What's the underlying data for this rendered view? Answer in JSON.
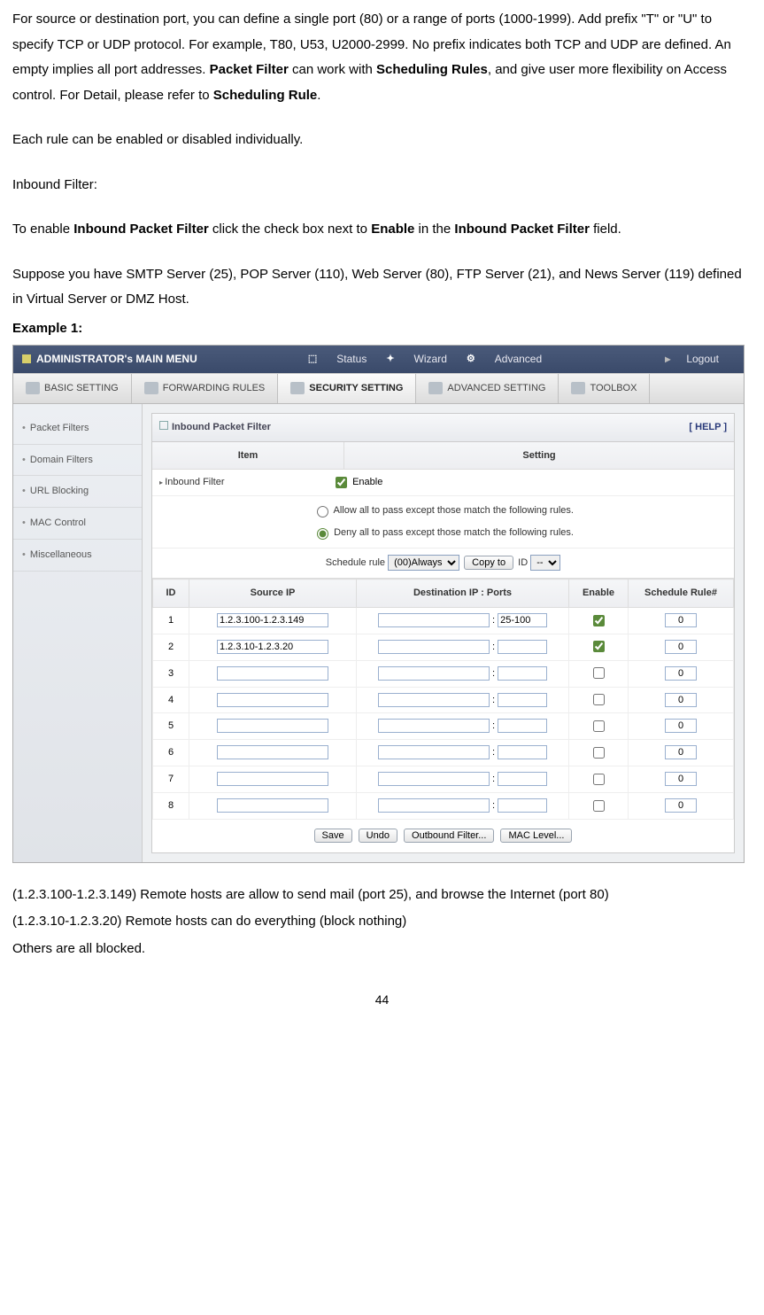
{
  "intro": {
    "p1_a": "For source or destination port, you can define a single port (80) or a range of ports (1000-1999). Add prefix \"T\" or \"U\" to specify TCP or UDP protocol. For example, T80, U53, U2000-2999. No prefix indicates both TCP and UDP are defined. An empty implies all port addresses. ",
    "p1_b1": "Packet Filter",
    "p1_c": " can work with ",
    "p1_b2": "Scheduling Rules",
    "p1_d": ", and give user more flexibility on Access control. For Detail, please refer to ",
    "p1_b3": "Scheduling Rule",
    "p1_e": ".",
    "p2": "Each rule can be enabled or disabled individually.",
    "p3": "Inbound Filter:",
    "p4_a": "To enable ",
    "p4_b1": "Inbound Packet Filter",
    "p4_c": " click the check box next to ",
    "p4_b2": "Enable",
    "p4_d": " in the ",
    "p4_b3": "Inbound Packet Filter",
    "p4_e": " field.",
    "p5": "Suppose you have SMTP Server (25), POP Server (110), Web Server (80), FTP Server (21), and News Server (119) defined in Virtual Server or DMZ Host.",
    "p6": "Example 1:"
  },
  "topbar": {
    "title": "ADMINISTRATOR's MAIN MENU",
    "status": "Status",
    "wizard": "Wizard",
    "advanced": "Advanced",
    "logout": "Logout"
  },
  "tabs": {
    "basic": "BASIC SETTING",
    "forwarding": "FORWARDING RULES",
    "security": "SECURITY SETTING",
    "advanced": "ADVANCED SETTING",
    "toolbox": "TOOLBOX"
  },
  "sidebar": {
    "items": [
      "Packet Filters",
      "Domain Filters",
      "URL Blocking",
      "MAC Control",
      "Miscellaneous"
    ]
  },
  "panel": {
    "title": "Inbound Packet Filter",
    "help": "[ HELP ]",
    "item_hdr": "Item",
    "setting_hdr": "Setting",
    "inbound_lbl": "Inbound Filter",
    "enable_lbl": "Enable",
    "radio_allow": "Allow all to pass except those match the following rules.",
    "radio_deny": "Deny all to pass except those match the following rules.",
    "sched_lbl": "Schedule rule",
    "sched_opt": "(00)Always",
    "copy_btn": "Copy to",
    "id_lbl": "ID",
    "id_opt": "--"
  },
  "rules": {
    "hdr_id": "ID",
    "hdr_src": "Source IP",
    "hdr_dst": "Destination IP : Ports",
    "hdr_enable": "Enable",
    "hdr_sched": "Schedule Rule#",
    "rows": [
      {
        "id": "1",
        "src": "1.2.3.100-1.2.3.149",
        "dst": "",
        "ports": "25-100",
        "enable": true,
        "sched": "0"
      },
      {
        "id": "2",
        "src": "1.2.3.10-1.2.3.20",
        "dst": "",
        "ports": "",
        "enable": true,
        "sched": "0"
      },
      {
        "id": "3",
        "src": "",
        "dst": "",
        "ports": "",
        "enable": false,
        "sched": "0"
      },
      {
        "id": "4",
        "src": "",
        "dst": "",
        "ports": "",
        "enable": false,
        "sched": "0"
      },
      {
        "id": "5",
        "src": "",
        "dst": "",
        "ports": "",
        "enable": false,
        "sched": "0"
      },
      {
        "id": "6",
        "src": "",
        "dst": "",
        "ports": "",
        "enable": false,
        "sched": "0"
      },
      {
        "id": "7",
        "src": "",
        "dst": "",
        "ports": "",
        "enable": false,
        "sched": "0"
      },
      {
        "id": "8",
        "src": "",
        "dst": "",
        "ports": "",
        "enable": false,
        "sched": "0"
      }
    ]
  },
  "buttons": {
    "save": "Save",
    "undo": "Undo",
    "outbound": "Outbound Filter...",
    "mac": "MAC Level..."
  },
  "footer": {
    "f1": "(1.2.3.100-1.2.3.149) Remote hosts are allow to send mail (port 25), and browse the Internet (port 80)",
    "f2": "(1.2.3.10-1.2.3.20) Remote hosts can do everything (block nothing)",
    "f3": "Others are all blocked."
  },
  "page_num": "44"
}
